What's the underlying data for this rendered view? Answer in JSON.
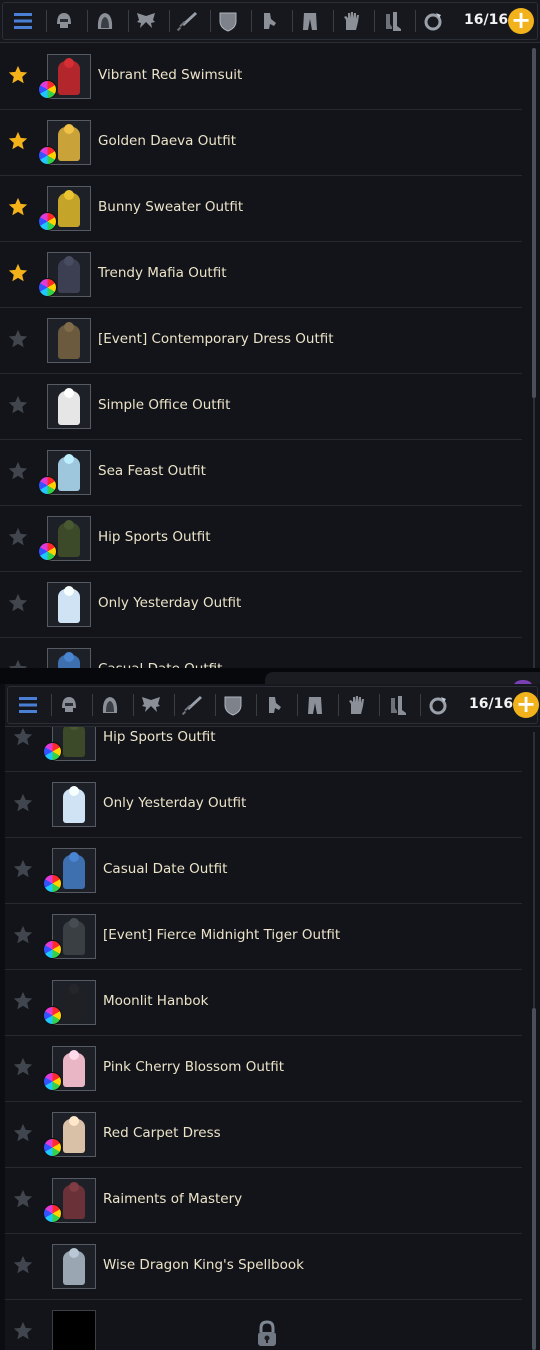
{
  "slot_count": "16/16",
  "colors": {
    "accent_gold": "#f1b21b",
    "star_active": "#f4b21a",
    "star_inactive": "#4e525b",
    "text": "#ece3c9"
  },
  "toolbar": {
    "icons": [
      "menu-icon",
      "helmet-icon",
      "hood-icon",
      "wings-icon",
      "sword-icon",
      "shield-icon",
      "gauntlet-icon",
      "pants-icon",
      "glove-icon",
      "boots-icon",
      "ring-icon"
    ],
    "add_button": "+"
  },
  "panel1": {
    "items": [
      {
        "label": "Vibrant Red Swimsuit",
        "favorite": true,
        "dye": true
      },
      {
        "label": "Golden Daeva Outfit",
        "favorite": true,
        "dye": true
      },
      {
        "label": "Bunny Sweater Outfit",
        "favorite": true,
        "dye": true
      },
      {
        "label": "Trendy Mafia Outfit",
        "favorite": true,
        "dye": true
      },
      {
        "label": "[Event] Contemporary Dress Outfit",
        "favorite": false,
        "dye": false
      },
      {
        "label": "Simple Office Outfit",
        "favorite": false,
        "dye": false
      },
      {
        "label": "Sea Feast Outfit",
        "favorite": false,
        "dye": true
      },
      {
        "label": "Hip Sports Outfit",
        "favorite": false,
        "dye": true
      },
      {
        "label": "Only Yesterday Outfit",
        "favorite": false,
        "dye": false
      },
      {
        "label": "Casual Date Outfit",
        "favorite": false,
        "dye": true
      }
    ]
  },
  "panel2": {
    "items": [
      {
        "label": "Hip Sports Outfit",
        "favorite": false,
        "dye": true
      },
      {
        "label": "Only Yesterday Outfit",
        "favorite": false,
        "dye": false
      },
      {
        "label": "Casual Date Outfit",
        "favorite": false,
        "dye": true
      },
      {
        "label": "[Event] Fierce Midnight Tiger Outfit",
        "favorite": false,
        "dye": true
      },
      {
        "label": "Moonlit Hanbok",
        "favorite": false,
        "dye": true
      },
      {
        "label": "Pink Cherry Blossom Outfit",
        "favorite": false,
        "dye": true
      },
      {
        "label": "Red Carpet Dress",
        "favorite": false,
        "dye": true
      },
      {
        "label": "Raiments of Mastery",
        "favorite": false,
        "dye": true
      },
      {
        "label": "Wise Dragon King's Spellbook",
        "favorite": false,
        "dye": false
      },
      {
        "label": "",
        "favorite": false,
        "dye": false,
        "locked": true
      }
    ]
  }
}
